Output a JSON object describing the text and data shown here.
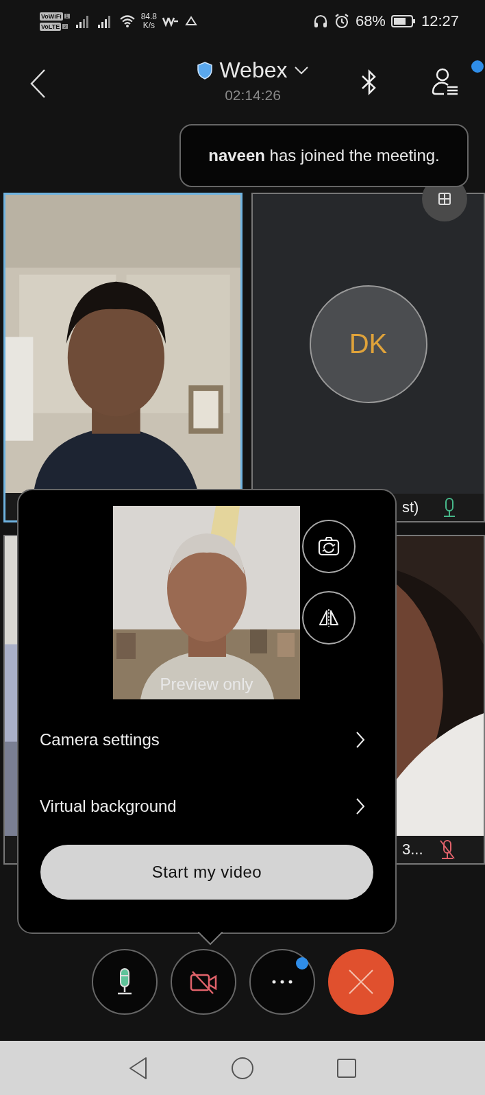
{
  "status_bar": {
    "vowifi": "VoWiFi",
    "sim1": "1",
    "volte": "VoLTE",
    "sim2": "2",
    "speed_value": "84.8",
    "speed_unit": "K/s",
    "battery_percent": "68%",
    "time": "12:27"
  },
  "header": {
    "title": "Webex",
    "timer": "02:14:26",
    "participants_badge": true
  },
  "toast": {
    "message": "**naveen** has joined the meeting."
  },
  "tiles": [
    {
      "kind": "video",
      "selected": true
    },
    {
      "kind": "avatar",
      "initials": "DK",
      "label": "st)",
      "mic_muted": false,
      "selected": false
    },
    {
      "kind": "video",
      "selected": false
    },
    {
      "kind": "video",
      "label": "3...",
      "mic_muted": true,
      "selected": false
    }
  ],
  "video_panel": {
    "preview_caption": "Preview only",
    "menu": [
      "Camera settings",
      "Virtual background"
    ],
    "button": "Start my video"
  },
  "controls": [
    {
      "kind": "mic",
      "muted": false
    },
    {
      "kind": "camera",
      "muted": true
    },
    {
      "kind": "more",
      "badge": true
    },
    {
      "kind": "leave"
    }
  ]
}
